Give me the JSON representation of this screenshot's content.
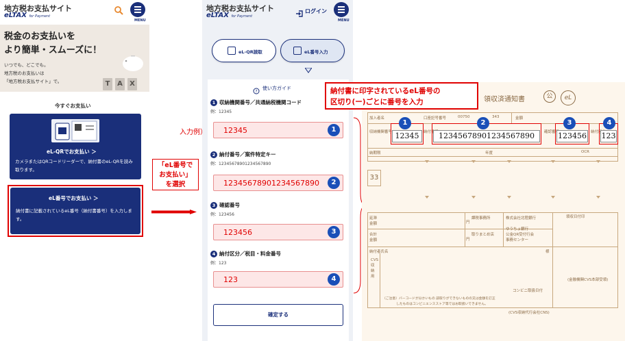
{
  "panel1": {
    "site_title": "地方税お支払サイト",
    "brand_main": "eLTAX",
    "brand_sub": "for Payment",
    "menu_label": "MENU",
    "hero_line1": "税金のお支払いを",
    "hero_line2": "より簡単・スムーズに！",
    "hero_sub1": "いつでも、どこでも。",
    "hero_sub2": "地方税のお支払いは",
    "hero_sub3": "「地方税お支払サイト」で。",
    "hero_blocks": [
      "T",
      "A",
      "X"
    ],
    "pay_now": "今すぐお支払い",
    "qr_card_title": "eL-QRでお支払い ＞",
    "qr_card_desc": "カメラまたはQRコードリーダーで、納付書のeL-QRを読み取ります。",
    "num_card_title": "eL番号でお支払い ＞",
    "num_card_desc": "納付書に記載されているeL番号（納付書番号）を入力します。"
  },
  "note": {
    "line1": "「eL番号で",
    "line2": "お支払い」",
    "line3": "を選択"
  },
  "panel2": {
    "site_title": "地方税お支払サイト",
    "brand_main": "eLTAX",
    "brand_sub": "for Payment",
    "login": "ログイン",
    "menu_label": "MENU",
    "tab_qr": "eL-QR読取",
    "tab_num": "eL番号入力",
    "guide": "使い方ガイド",
    "fields": [
      {
        "no": "1",
        "label": "収納機関番号／共通納税機関コード",
        "example": "例：12345",
        "value": "12345"
      },
      {
        "no": "2",
        "label": "納付番号／案件特定キー",
        "example": "例：12345678901234567890",
        "value": "12345678901234567890"
      },
      {
        "no": "3",
        "label": "確認番号",
        "example": "例：123456",
        "value": "123456"
      },
      {
        "no": "4",
        "label": "納付区分／税目・料金番号",
        "example": "例：123",
        "value": "123"
      }
    ],
    "confirm": "確定する"
  },
  "example_label": "入力例）",
  "annotation": {
    "line1": "納付書に印字されているeL番号の",
    "line2": "区切り(ー)ごとに番号を入力"
  },
  "receipt": {
    "title": "領収済通知書",
    "stamp": "公",
    "logo": "eL",
    "hdr_add": "加入者名",
    "hdr_code": "口座記号番号",
    "hdr_num": "00750",
    "hdr_num2": "343",
    "hdr_amount": "金額",
    "row_recv": "収納機関番号",
    "row_pay": "納付番号",
    "row_check": "確認番号",
    "row_kubun": "納付区分",
    "row_nofu": "納期限",
    "row_nendo": "年度",
    "row_ocr": "OCR",
    "num33": "33",
    "val1": "12345",
    "val2": "12345678901234567890",
    "val3": "123456",
    "val4": "123",
    "late": "延滞金額",
    "total": "合計金額",
    "yen": "円",
    "office": "課税事務所",
    "office2": "取りまとめ店",
    "bank": "株式会社北陸銀行",
    "bank2": "ゆうちょ銀行",
    "bank3": "公金QR受付行会",
    "bank4": "事務センター",
    "payer": "納付者氏名",
    "sama": "様",
    "receipt_date": "領収日付印",
    "cvs": "CVS収納用",
    "cvs_office": "コンビニ取扱日付",
    "note_bc1": "（ご注意）バーコードが分かいもの 読取りができないものの又は金額を訂正",
    "note_bc2": "したものはコンビニエンスストア等ではお取扱いできません。",
    "cvs_bottom": "(CVS収納代行会社CNS)",
    "stamp_note": "(金融機関CVS本部受領)"
  }
}
